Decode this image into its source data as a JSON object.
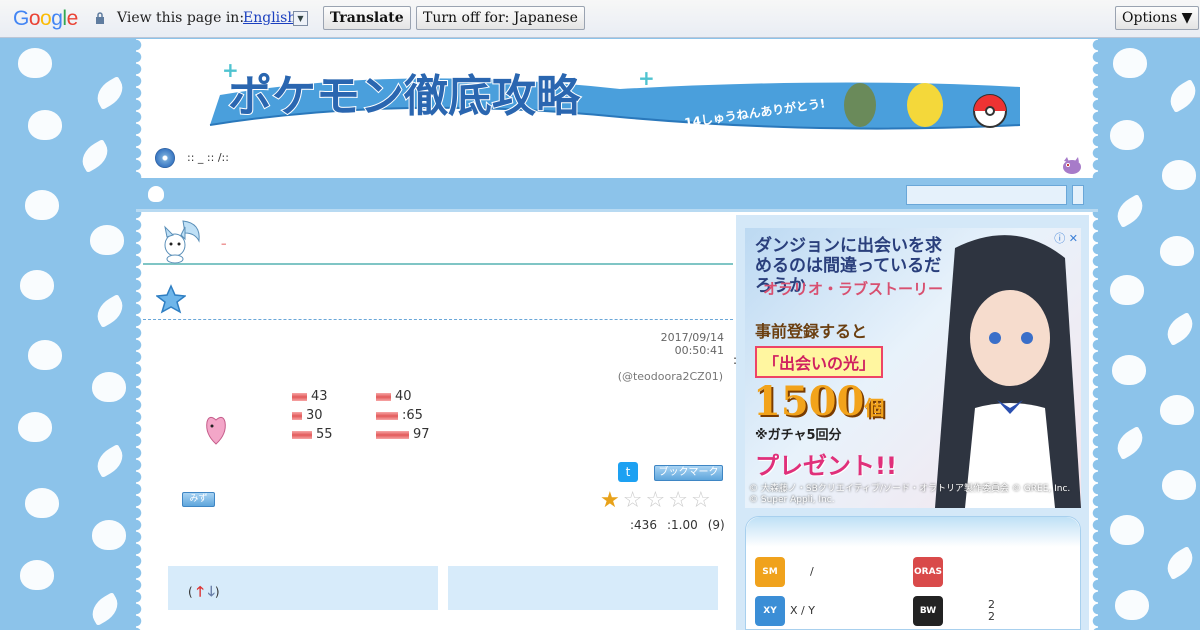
{
  "translate_bar": {
    "logo_text": "Google",
    "prompt": "View this page in:",
    "language": "English",
    "dropdown_glyph": "▼",
    "translate_label": "Translate",
    "turn_off_label": "Turn off for: Japanese",
    "options_label": "Options ▼"
  },
  "header": {
    "site_title": "ポケモン徹底攻略",
    "tagline": "14しゅうねんありがとう!",
    "breadcrumb": ":: _ ::  /::"
  },
  "post": {
    "red_mark": "–",
    "date": "2017/09/14  00:50:41",
    "colon": ":",
    "author": "(@teodoora2CZ01)",
    "stats": [
      {
        "label": "43",
        "fill": 0.35
      },
      {
        "label": "40",
        "fill": 0.35
      },
      {
        "label": "30",
        "fill": 0.25
      },
      {
        "label": ":65",
        "fill": 0.55
      },
      {
        "label": "55",
        "fill": 0.45
      },
      {
        "label": "97",
        "fill": 0.8
      }
    ],
    "twitter_glyph": "t",
    "bookmark_label": "ブックマーク",
    "mizu_label": "みず",
    "stars_on": 1,
    "stars_total": 5,
    "rating_count": ":436",
    "rating_avg": ":1.00",
    "rating_votes": "(9)",
    "vote_open": "(",
    "vote_up": "🡑",
    "vote_down": "🡓",
    "vote_close": ")"
  },
  "ad": {
    "title": "ダンジョンに出会いを求めるのは間違っているだろうか",
    "subtitle": "オラリオ・ラブストーリー",
    "line1": "事前登録すると",
    "line2": "「出会いの光」",
    "big_number": "1500",
    "big_unit": "個",
    "note": "※ガチャ5回分",
    "present": "プレゼント!!",
    "copyright": "© 大森藤ノ・SBクリエイティブ/ソード・オラトリア製作委員会 © GREE, Inc. © Super Appli, Inc.",
    "close": "ⓘ ✕"
  },
  "sidebar": {
    "games": [
      {
        "logo": "SM",
        "label": "/",
        "color": "#f0a21c"
      },
      {
        "logo": "ORAS",
        "label": "",
        "color": "#d94a4a"
      },
      {
        "logo": "XY",
        "label": "X / Y",
        "color": "#3b8ed6"
      },
      {
        "logo": "BW",
        "label": "2\n2",
        "color": "#222222"
      }
    ]
  }
}
